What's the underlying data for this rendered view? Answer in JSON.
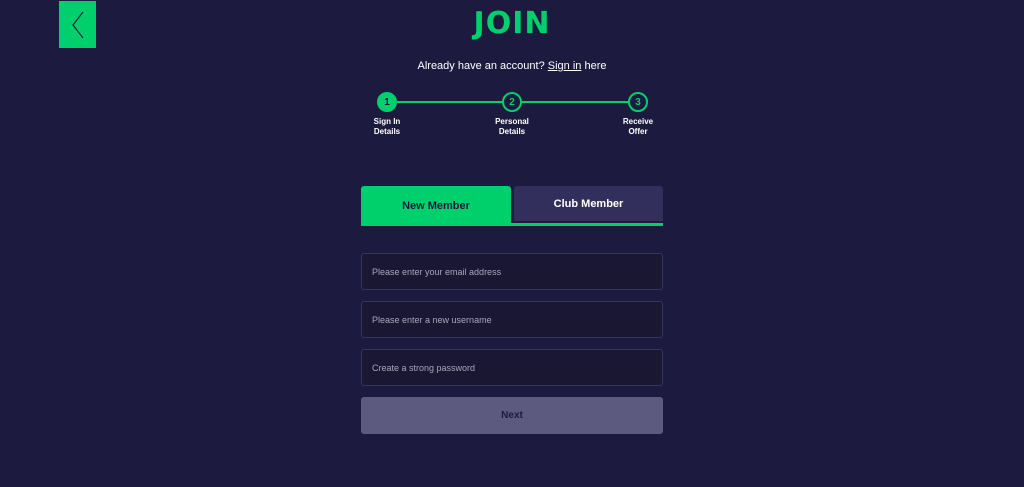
{
  "header": {
    "back_icon": "chevron-left-icon",
    "title": "JOIN"
  },
  "signin": {
    "prefix": "Already have an account?",
    "link": "Sign in",
    "suffix": "here"
  },
  "stepper": {
    "steps": [
      {
        "number": "1",
        "label_line1": "Sign In",
        "label_line2": "Details",
        "active": true
      },
      {
        "number": "2",
        "label_line1": "Personal",
        "label_line2": "Details",
        "active": false
      },
      {
        "number": "3",
        "label_line1": "Receive",
        "label_line2": "Offer",
        "active": false
      }
    ]
  },
  "tabs": {
    "new_member": "New Member",
    "club_member": "Club Member"
  },
  "form": {
    "email_placeholder": "Please enter your email address",
    "username_placeholder": "Please enter a new username",
    "password_placeholder": "Create a strong password",
    "next_label": "Next"
  },
  "colors": {
    "background": "#1d1a40",
    "accent": "#00d06c",
    "tab_inactive": "#332f5c",
    "field_bg": "#191731",
    "button_disabled": "#5d5a7f"
  }
}
